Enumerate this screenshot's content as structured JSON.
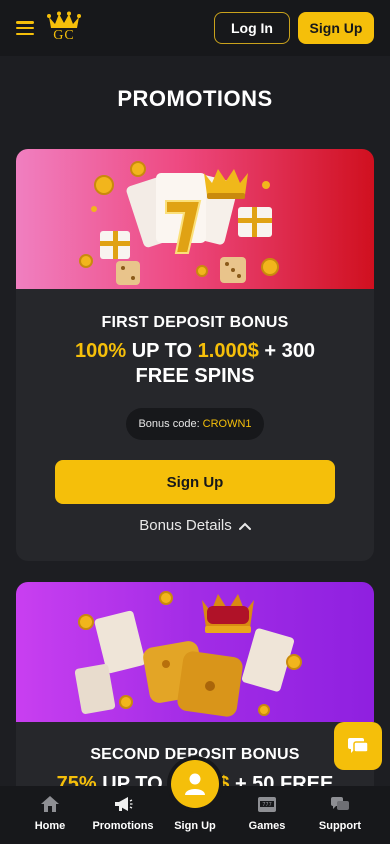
{
  "header": {
    "logo_text": "GC",
    "login_label": "Log In",
    "signup_label": "Sign Up"
  },
  "page_title": "PROMOTIONS",
  "promotions": [
    {
      "title": "FIRST DEPOSIT BONUS",
      "offer_pct": "100%",
      "offer_upto": " UP TO ",
      "offer_amount": "1.000$",
      "offer_rest": " + 300",
      "offer_line2": "FREE SPINS",
      "code_label": "Bonus code:",
      "code_value": "CROWN1",
      "button_label": "Sign Up",
      "details_label": "Bonus Details"
    },
    {
      "title": "SECOND DEPOSIT BONUS",
      "offer_pct": "75%",
      "offer_upto": " UP TO ",
      "offer_amount": "1.000$",
      "offer_rest": " + 50 FREE"
    }
  ],
  "bottom_nav": {
    "items": [
      {
        "label": "Home",
        "icon": "home-icon"
      },
      {
        "label": "Promotions",
        "icon": "megaphone-icon"
      },
      {
        "label": "Sign Up",
        "icon": "user-icon"
      },
      {
        "label": "Games",
        "icon": "slot-machine-icon"
      },
      {
        "label": "Support",
        "icon": "chat-bubbles-icon"
      }
    ]
  },
  "colors": {
    "accent": "#f5bf0a",
    "background": "#1d1e22",
    "card": "#26272b",
    "header": "#17181b"
  }
}
